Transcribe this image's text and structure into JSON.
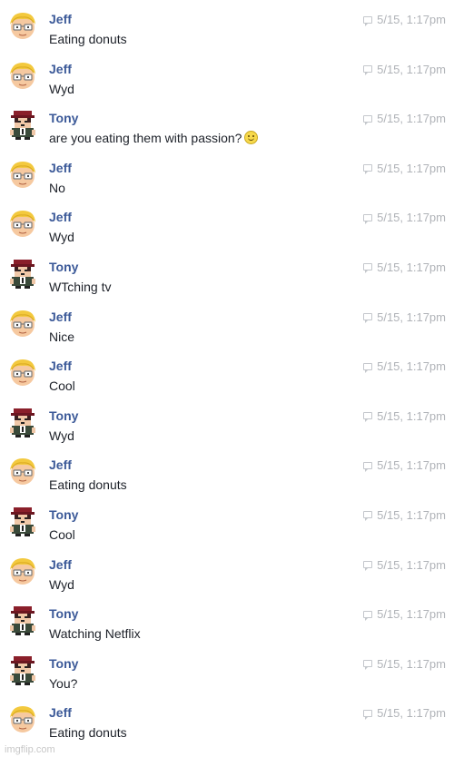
{
  "messages": [
    {
      "sender": "Jeff",
      "text": "Eating donuts",
      "time": "5/15, 1:17pm",
      "avatar": "jeff"
    },
    {
      "sender": "Jeff",
      "text": "Wyd",
      "time": "5/15, 1:17pm",
      "avatar": "jeff"
    },
    {
      "sender": "Tony",
      "text": "are you eating them with passion?",
      "time": "5/15, 1:17pm",
      "avatar": "tony",
      "emoji": "smile"
    },
    {
      "sender": "Jeff",
      "text": "No",
      "time": "5/15, 1:17pm",
      "avatar": "jeff"
    },
    {
      "sender": "Jeff",
      "text": "Wyd",
      "time": "5/15, 1:17pm",
      "avatar": "jeff"
    },
    {
      "sender": "Tony",
      "text": "WTching tv",
      "time": "5/15, 1:17pm",
      "avatar": "tony"
    },
    {
      "sender": "Jeff",
      "text": "Nice",
      "time": "5/15, 1:17pm",
      "avatar": "jeff"
    },
    {
      "sender": "Jeff",
      "text": "Cool",
      "time": "5/15, 1:17pm",
      "avatar": "jeff"
    },
    {
      "sender": "Tony",
      "text": "Wyd",
      "time": "5/15, 1:17pm",
      "avatar": "tony"
    },
    {
      "sender": "Jeff",
      "text": "Eating donuts",
      "time": "5/15, 1:17pm",
      "avatar": "jeff"
    },
    {
      "sender": "Tony",
      "text": "Cool",
      "time": "5/15, 1:17pm",
      "avatar": "tony"
    },
    {
      "sender": "Jeff",
      "text": "Wyd",
      "time": "5/15, 1:17pm",
      "avatar": "jeff"
    },
    {
      "sender": "Tony",
      "text": "Watching Netflix",
      "time": "5/15, 1:17pm",
      "avatar": "tony"
    },
    {
      "sender": "Tony",
      "text": "You?",
      "time": "5/15, 1:17pm",
      "avatar": "tony"
    },
    {
      "sender": "Jeff",
      "text": "Eating donuts",
      "time": "5/15, 1:17pm",
      "avatar": "jeff"
    }
  ],
  "watermark": "imgflip.com"
}
